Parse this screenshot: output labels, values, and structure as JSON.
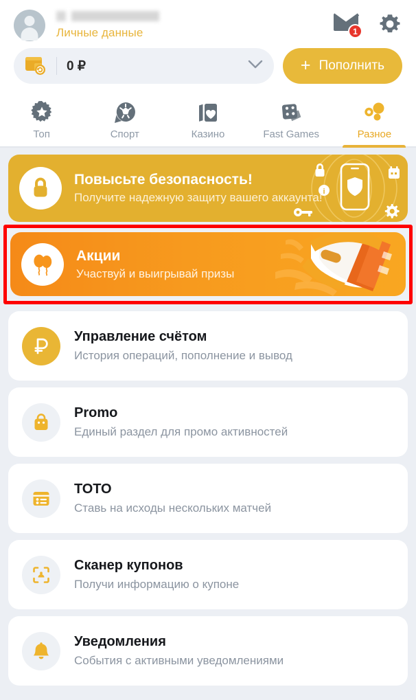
{
  "header": {
    "avatar_icon": "user-avatar-icon",
    "username_redacted": "",
    "personal_data_label": "Личные данные",
    "mail_icon": "mail-icon",
    "mail_badge_count": "1",
    "settings_icon": "gear-icon"
  },
  "balance": {
    "wallet_icon": "wallet-refresh-icon",
    "amount": "0 ₽",
    "chevron_icon": "chevron-down-icon",
    "topup_plus": "+",
    "topup_label": "Пополнить"
  },
  "tabs": [
    {
      "label": "Топ",
      "icon": "star-burst-icon",
      "active": false
    },
    {
      "label": "Спорт",
      "icon": "soccer-ball-icon",
      "active": false
    },
    {
      "label": "Казино",
      "icon": "playing-cards-icon",
      "active": false
    },
    {
      "label": "Fast Games",
      "icon": "dice-icon",
      "active": false
    },
    {
      "label": "Разное",
      "icon": "dots-cluster-icon",
      "active": true
    }
  ],
  "banners": [
    {
      "id": "security",
      "icon": "padlock-icon",
      "title": "Повысьте безопасность!",
      "subtitle": "Получите надежную защиту вашего аккаунта!",
      "art": "phone-shield-illustration",
      "bg_color": "#e3b02f",
      "highlighted": false
    },
    {
      "id": "promo",
      "icon": "balloons-icon",
      "title": "Акции",
      "subtitle": "Участвуй и выигрывай призы",
      "art": "megaphone-illustration",
      "bg_color": "#f7951c",
      "highlighted": true,
      "highlight_color": "#fe0000"
    }
  ],
  "list_items": [
    {
      "icon": "ruble-circle-icon",
      "icon_style": "filled",
      "title": "Управление счётом",
      "subtitle": "История операций, пополнение и вывод"
    },
    {
      "icon": "shopping-bag-icon",
      "icon_style": "light",
      "title": "Promo",
      "subtitle": "Единый раздел для промо активностей"
    },
    {
      "icon": "toto-list-icon",
      "icon_style": "light",
      "title": "ТОТО",
      "subtitle": "Ставь на исходы нескольких матчей"
    },
    {
      "icon": "coupon-scanner-icon",
      "icon_style": "light",
      "title": "Сканер купонов",
      "subtitle": "Получи информацию о купоне"
    },
    {
      "icon": "bell-icon",
      "icon_style": "light",
      "title": "Уведомления",
      "subtitle": "События с активными уведомлениями"
    }
  ],
  "colors": {
    "accent": "#e8b93a",
    "promo_orange": "#f7951c",
    "badge_red": "#e8352b",
    "page_bg": "#eceff4",
    "muted_text": "#8b94a0"
  }
}
